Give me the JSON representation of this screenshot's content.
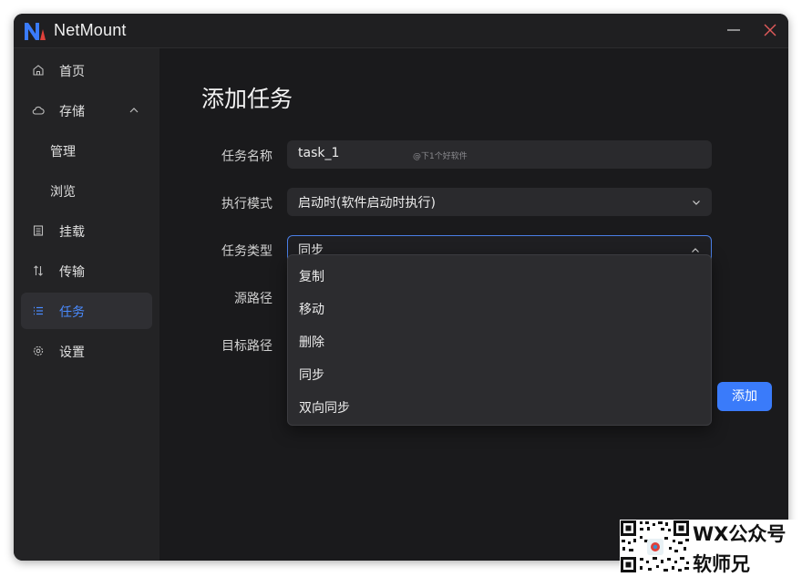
{
  "window": {
    "title": "NetMount"
  },
  "sidebar": {
    "items": [
      {
        "label": "首页",
        "icon": "home-icon"
      },
      {
        "label": "存储",
        "icon": "cloud-icon"
      },
      {
        "label": "管理"
      },
      {
        "label": "浏览"
      },
      {
        "label": "挂载",
        "icon": "mount-icon"
      },
      {
        "label": "传输",
        "icon": "transfer-icon"
      },
      {
        "label": "任务",
        "icon": "task-list-icon"
      },
      {
        "label": "设置",
        "icon": "gear-icon"
      }
    ],
    "active": "任务"
  },
  "page": {
    "title": "添加任务"
  },
  "form": {
    "task_name": {
      "label": "任务名称",
      "value": "task_1",
      "watermark": "@下1个好软件"
    },
    "exec_mode": {
      "label": "执行模式",
      "value": "启动时(软件启动时执行)"
    },
    "task_type": {
      "label": "任务类型",
      "value": "同步",
      "options": [
        "复制",
        "移动",
        "删除",
        "同步",
        "双向同步"
      ]
    },
    "source_path": {
      "label": "源路径"
    },
    "target_path": {
      "label": "目标路径"
    },
    "add_label": "添加"
  },
  "badge": {
    "line1": "WX公众号",
    "line2": "软师兄"
  },
  "colors": {
    "accent": "#3a7bfa",
    "background": "#1a1a1c",
    "sidebar": "#232325",
    "close": "#e05a5a"
  }
}
